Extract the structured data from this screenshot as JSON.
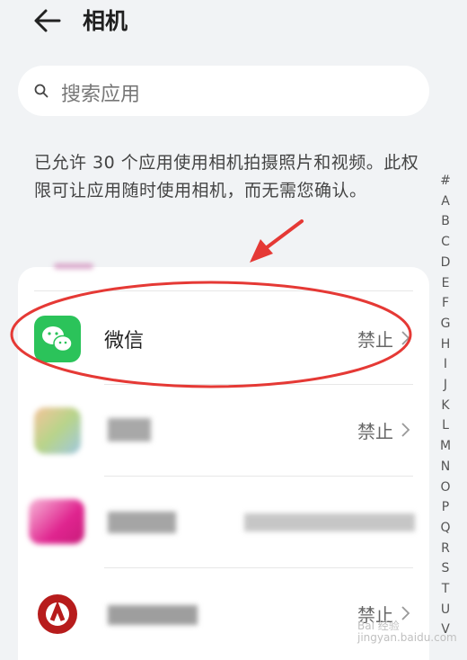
{
  "header": {
    "title": "相机"
  },
  "search": {
    "placeholder": "搜索应用"
  },
  "description": "已允许 30 个应用使用相机拍摄照片和视频。此权限可让应用随时使用相机，而无需您确认。",
  "apps": [
    {
      "name": "微信",
      "status": "禁止",
      "icon": "wechat-icon"
    },
    {
      "name": "",
      "status": "禁止",
      "icon": "blurred-app-icon"
    },
    {
      "name": "",
      "status": "",
      "icon": "blurred-app-icon"
    },
    {
      "name": "",
      "status": "禁止",
      "icon": "red-app-icon"
    }
  ],
  "alphabet": [
    "#",
    "A",
    "B",
    "C",
    "D",
    "E",
    "F",
    "G",
    "H",
    "I",
    "J",
    "K",
    "L",
    "M",
    "N",
    "O",
    "P",
    "Q",
    "R",
    "S",
    "T",
    "U",
    "V"
  ],
  "watermark": {
    "line1": "Bai 经验",
    "line2": "jingyan.baidu.com"
  },
  "colors": {
    "annotation": "#e53935",
    "wechat_green": "#2bc35a",
    "background": "#f1f3f5"
  }
}
